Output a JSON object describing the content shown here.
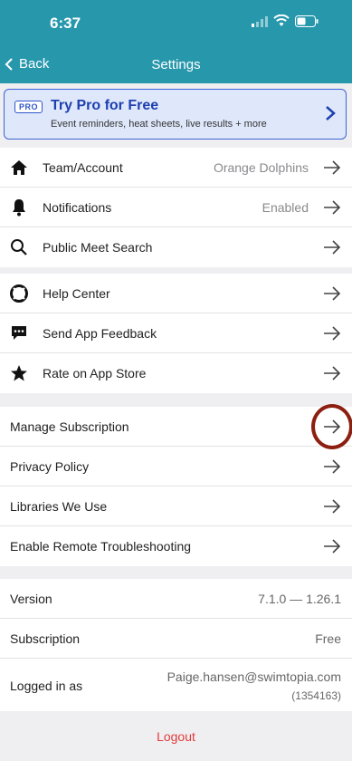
{
  "status": {
    "time": "6:37"
  },
  "nav": {
    "back_label": "Back",
    "title": "Settings"
  },
  "promo": {
    "badge": "PRO",
    "title": "Try Pro for Free",
    "subtitle": "Event reminders, heat sheets, live results + more"
  },
  "group1": [
    {
      "label": "Team/Account",
      "value": "Orange Dolphins",
      "icon": "home-icon"
    },
    {
      "label": "Notifications",
      "value": "Enabled",
      "icon": "bell-icon"
    },
    {
      "label": "Public Meet Search",
      "value": "",
      "icon": "search-icon"
    }
  ],
  "group2": [
    {
      "label": "Help Center",
      "icon": "lifebuoy-icon"
    },
    {
      "label": "Send App Feedback",
      "icon": "chat-icon"
    },
    {
      "label": "Rate on App Store",
      "icon": "star-icon"
    }
  ],
  "group3": [
    {
      "label": "Manage Subscription"
    },
    {
      "label": "Privacy Policy"
    },
    {
      "label": "Libraries We Use"
    },
    {
      "label": "Enable Remote Troubleshooting"
    }
  ],
  "info": {
    "version_label": "Version",
    "version_value": "7.1.0 — 1.26.1",
    "subscription_label": "Subscription",
    "subscription_value": "Free",
    "logged_label": "Logged in as",
    "logged_email": "Paige.hansen@swimtopia.com",
    "logged_id": "(1354163)"
  },
  "logout_label": "Logout",
  "colors": {
    "header": "#2797ac",
    "promo_bg": "#dfe8fb",
    "promo_accent": "#1d3fb0",
    "logout": "#e23b3b",
    "highlight": "#8c1f10"
  }
}
